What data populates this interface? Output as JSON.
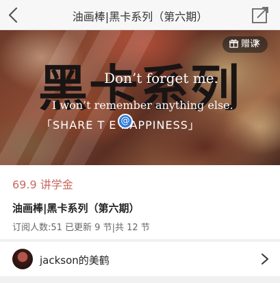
{
  "navbar": {
    "title": "油画棒|黑卡系列（第六期）",
    "back_icon": "chevron-left-icon",
    "share_icon": "share-external-icon"
  },
  "banner": {
    "big_title": "黑卡系列",
    "subtitle_en": "Don’t forget me.",
    "line2": "I won’t remember anything else.",
    "share_text": "「SHARE T  E HAPPINESS」",
    "logo_glyph": "@",
    "gift_badge_label": "赠课",
    "gift_icon": "gift-icon",
    "close_glyph": "×"
  },
  "course": {
    "price": "69.9 讲学金",
    "title": "油画棒|黑卡系列（第六期）",
    "meta": "订阅人数:51 已更新 9 节|共 12 节"
  },
  "author": {
    "name": "jackson的美鹤",
    "arrow_icon": "chevron-right-icon"
  },
  "colors": {
    "price": "#c96a5f",
    "nav_bg": "#f7f7f7",
    "page_bg": "#f1f1f1"
  }
}
